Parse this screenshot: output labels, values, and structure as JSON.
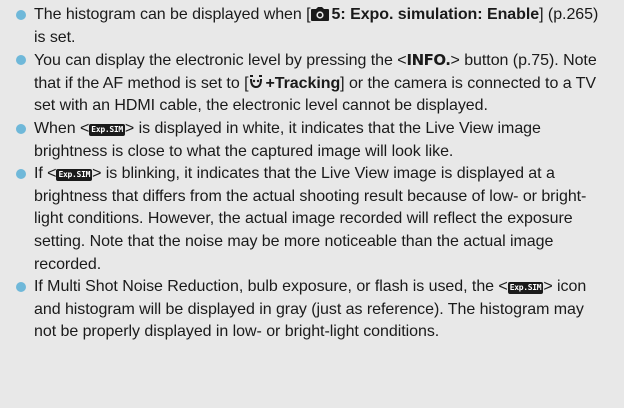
{
  "accent_color": "#6fb8d9",
  "icons": {
    "camera_tab": "camera-shooting-tab-icon",
    "face_tracking": "face-tracking-icon",
    "exp_sim": "exposure-simulation-indicator-icon"
  },
  "bullets": [
    {
      "before": "The histogram can be displayed when [",
      "menu_bold": "5: Expo. simulation: Enable",
      "after": "] (p.265) is set."
    },
    {
      "before": "You can display the electronic level by pressing the <",
      "info_label": "INFO.",
      "middle": "> button (p.75). Note that if the AF method is set to [",
      "af_bold": "+Tracking",
      "after": "] or the camera is connected to a TV set with an HDMI cable, the electronic level cannot be displayed."
    },
    {
      "before": "When <",
      "badge": "Exp.SIM",
      "after": "> is displayed in white, it indicates that the Live View image brightness is close to what the captured image will look like."
    },
    {
      "before": "If <",
      "badge": "Exp.SIM",
      "after": "> is blinking, it indicates that the Live View image is displayed at a brightness that differs from the actual shooting result because of low- or bright-light conditions. However, the actual image recorded will reflect the exposure setting. Note that the noise may be more noticeable than the actual image recorded."
    },
    {
      "before": "If Multi Shot Noise Reduction, bulb exposure, or flash is used, the <",
      "badge": "Exp.SIM",
      "after": "> icon and histogram will be displayed in gray (just as reference). The histogram may not be properly displayed in low- or bright-light conditions."
    }
  ]
}
